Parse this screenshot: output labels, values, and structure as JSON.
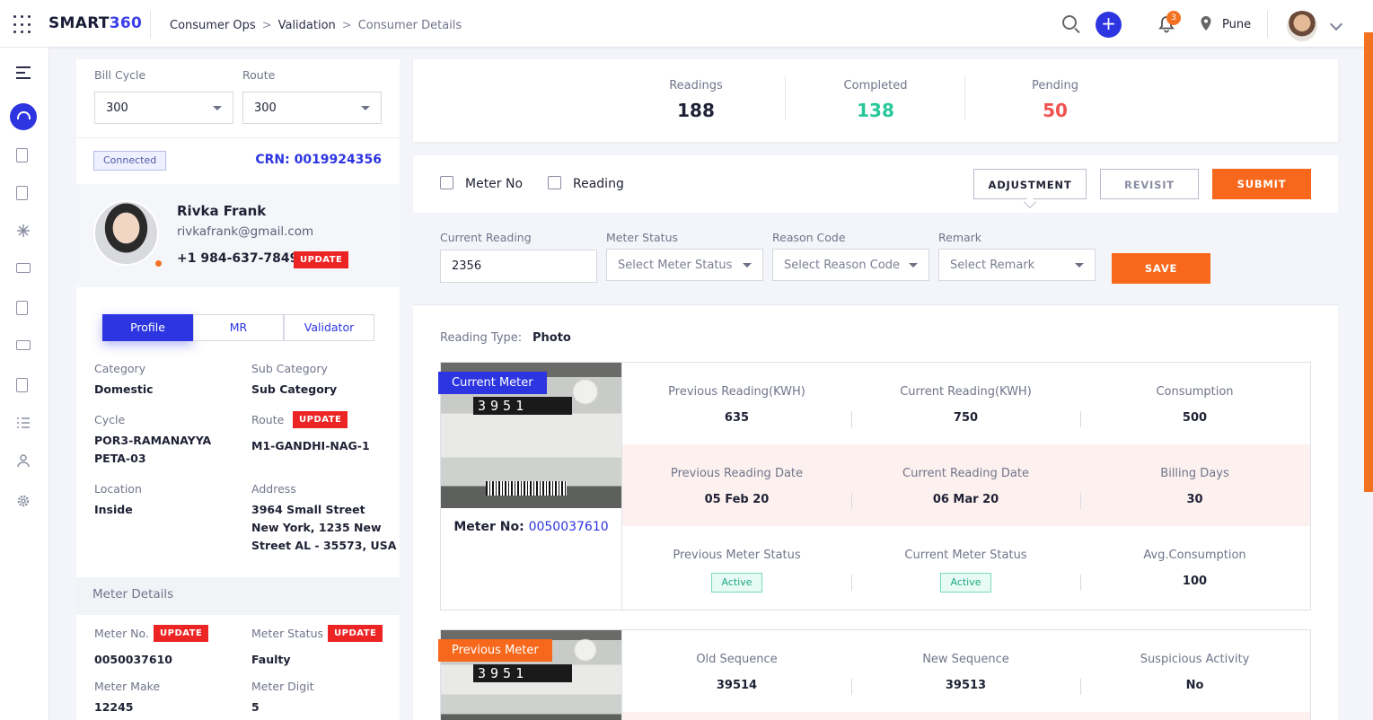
{
  "app": {
    "brand_prefix": "SMART",
    "brand_suffix": "360"
  },
  "breadcrumb": [
    "Consumer Ops",
    "Validation",
    "Consumer Details"
  ],
  "breadcrumb_sep": ">",
  "header": {
    "notifications": "3",
    "city": "Pune",
    "plus": "+"
  },
  "filters": {
    "bill_cycle_label": "Bill Cycle",
    "bill_cycle_value": "300",
    "route_label": "Route",
    "route_value": "300"
  },
  "consumer": {
    "status": "Connected",
    "crn": "CRN: 0019924356",
    "name": "Rivka Frank",
    "email": "rivkafrank@gmail.com",
    "phone": "+1 984-637-7849",
    "update": "UPDATE"
  },
  "tabs": [
    "Profile",
    "MR",
    "Validator"
  ],
  "profile": {
    "category_label": "Category",
    "category": "Domestic",
    "sub_category_label": "Sub Category",
    "sub_category": "Sub Category",
    "cycle_label": "Cycle",
    "cycle_line1": "POR3-RAMANAYYA",
    "cycle_line2": "PETA-03",
    "route_label": "Route",
    "route": "M1-GANDHI-NAG-1",
    "location_label": "Location",
    "location": "Inside",
    "address_label": "Address",
    "address_line1": "3964 Small Street",
    "address_line2": "New York, 1235 New",
    "address_line3": "Street AL - 35573, USA"
  },
  "meter_details": {
    "heading": "Meter Details",
    "meter_no_label": "Meter No.",
    "meter_no": "0050037610",
    "meter_status_label": "Meter Status",
    "meter_status": "Faulty",
    "meter_make_label": "Meter Make",
    "meter_make": "12245",
    "meter_digit_label": "Meter Digit",
    "meter_digit": "5"
  },
  "summary": {
    "readings_label": "Readings",
    "readings": "188",
    "completed_label": "Completed",
    "completed": "138",
    "pending_label": "Pending",
    "pending": "50"
  },
  "actions": {
    "meter_no": "Meter No",
    "reading": "Reading",
    "adjustment": "ADJUSTMENT",
    "revisit": "REVISIT",
    "submit": "SUBMIT"
  },
  "form": {
    "current_reading_label": "Current Reading",
    "current_reading": "2356",
    "meter_status_label": "Meter Status",
    "meter_status_ph": "Select Meter Status",
    "reason_code_label": "Reason Code",
    "reason_code_ph": "Select Reason Code",
    "remark_label": "Remark",
    "remark_ph": "Select Remark",
    "save": "SAVE"
  },
  "reading_type": {
    "label": "Reading Type:",
    "value": "Photo"
  },
  "current_meter": {
    "ribbon": "Current Meter",
    "meter_no_label": "Meter No:",
    "meter_no": "0050037610",
    "dial": "3951",
    "prev_reading_label": "Previous Reading(KWH)",
    "prev_reading": "635",
    "curr_reading_label": "Current Reading(KWH)",
    "curr_reading": "750",
    "consumption_label": "Consumption",
    "consumption": "500",
    "prev_date_label": "Previous Reading Date",
    "prev_date": "05 Feb 20",
    "curr_date_label": "Current Reading Date",
    "curr_date": "06 Mar 20",
    "billing_days_label": "Billing Days",
    "billing_days": "30",
    "prev_status_label": "Previous Meter Status",
    "prev_status": "Active",
    "curr_status_label": "Current Meter Status",
    "curr_status": "Active",
    "avg_label": "Avg.Consumption",
    "avg": "100"
  },
  "previous_meter": {
    "ribbon": "Previous Meter",
    "dial": "3951",
    "old_seq_label": "Old Sequence",
    "old_seq": "39514",
    "new_seq_label": "New Sequence",
    "new_seq": "39513",
    "suspicious_label": "Suspicious Activity",
    "suspicious": "No"
  },
  "colors": {
    "primary": "#2c35e0",
    "accent": "#f7681c",
    "completed": "#27c79a",
    "pending": "#f0524f",
    "danger": "#ec2424"
  }
}
